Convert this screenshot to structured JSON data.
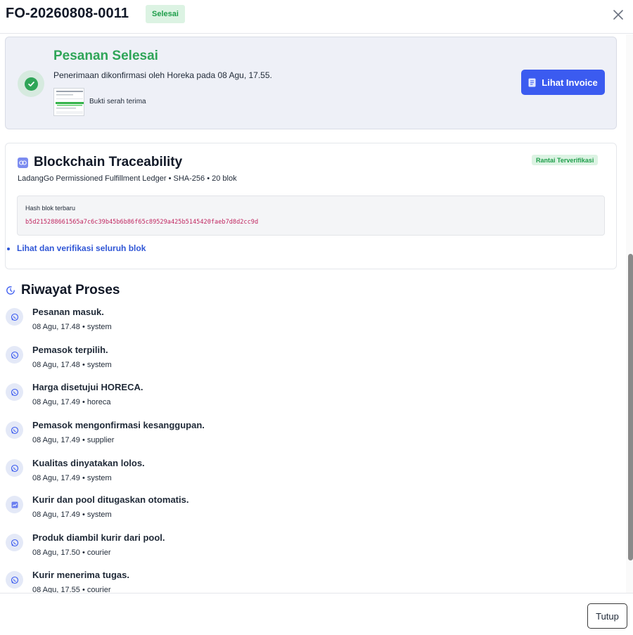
{
  "header": {
    "order_id": "FO-20260808-0011",
    "status": "Selesai"
  },
  "completion": {
    "title": "Pesanan Selesai",
    "description": "Penerimaan dikonfirmasi oleh Horeka pada 08 Agu, 17.55.",
    "proof_label": "Bukti serah terima",
    "invoice_button": "Lihat Invoice"
  },
  "blockchain": {
    "title": "Blockchain Traceability",
    "badge": "Rantai Terverifikasi",
    "subtitle": "LadangGo Permissioned Fulfillment Ledger • SHA-256 • 20 blok",
    "hash_label": "Hash blok terbaru",
    "hash_value": "b5d215288661565a7c6c39b45b6b86f65c89529a425b5145420faeb7d8d2cc9d",
    "verify_link": "Lihat dan verifikasi seluruh blok"
  },
  "history": {
    "title": "Riwayat Proses",
    "items": [
      {
        "title": "Pesanan masuk.",
        "meta": "08 Agu, 17.48 • system",
        "icon": "whatsapp-icon"
      },
      {
        "title": "Pemasok terpilih.",
        "meta": "08 Agu, 17.48 • system",
        "icon": "whatsapp-icon"
      },
      {
        "title": "Harga disetujui HORECA.",
        "meta": "08 Agu, 17.49 • horeca",
        "icon": "whatsapp-icon"
      },
      {
        "title": "Pemasok mengonfirmasi kesanggupan.",
        "meta": "08 Agu, 17.49 • supplier",
        "icon": "whatsapp-icon"
      },
      {
        "title": "Kualitas dinyatakan lolos.",
        "meta": "08 Agu, 17.49 • system",
        "icon": "whatsapp-icon"
      },
      {
        "title": "Kurir dan pool ditugaskan otomatis.",
        "meta": "08 Agu, 17.49 • system",
        "icon": "dashboard-icon"
      },
      {
        "title": "Produk diambil kurir dari pool.",
        "meta": "08 Agu, 17.50 • courier",
        "icon": "whatsapp-icon"
      },
      {
        "title": "Kurir menerima tugas.",
        "meta": "08 Agu, 17.55 • courier",
        "icon": "whatsapp-icon"
      }
    ]
  },
  "footer": {
    "close_button": "Tutup"
  },
  "colors": {
    "accent": "#3b5bf0",
    "success": "#2fa558",
    "hash": "#c02660",
    "link": "#2f56d6"
  }
}
